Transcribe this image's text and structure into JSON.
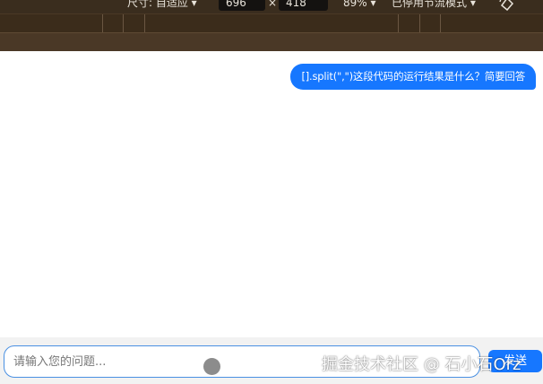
{
  "toolbar": {
    "size_label": "尺寸: 自适应 ▾",
    "width_value": "696",
    "times_sign": "×",
    "height_value": "418",
    "zoom": "89% ▾",
    "throttle": "已停用节流模式 ▾",
    "rotate_icon": "rotate-icon"
  },
  "chat": {
    "messages": [
      {
        "role": "user",
        "text": "[].split(\",\")这段代码的运行结果是什么？简要回答"
      }
    ]
  },
  "composer": {
    "placeholder": "请输入您的问题...",
    "send_label": "发送"
  },
  "watermark": "掘金技术社区 @ 石小石Orz",
  "colors": {
    "accent": "#1677ff",
    "toolbar_bg": "#3a2d1e",
    "input_border": "#4a90e2"
  }
}
